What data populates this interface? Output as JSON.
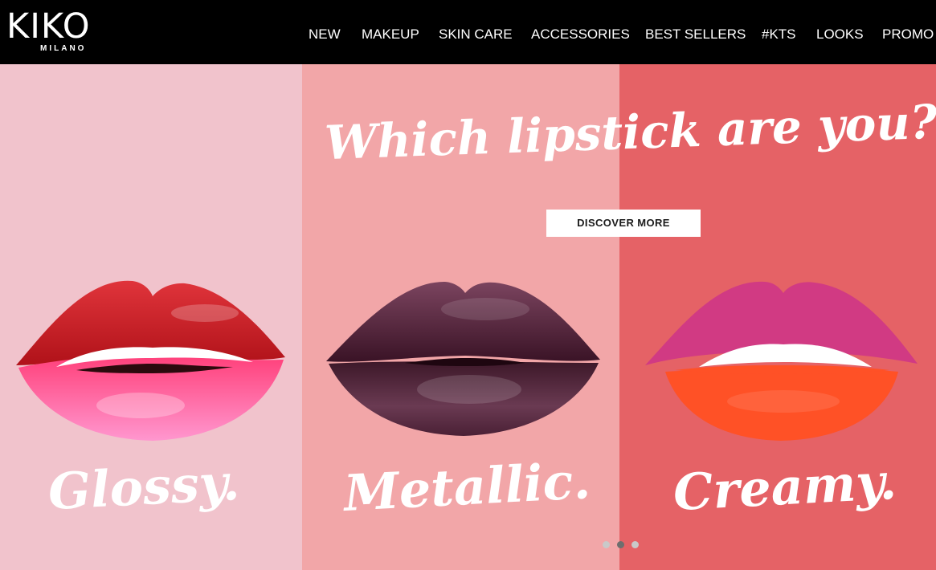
{
  "header": {
    "logo_main": "KIKO",
    "logo_sub": "MILANO",
    "nav": [
      "NEW",
      "MAKEUP",
      "SKIN CARE",
      "ACCESSORIES",
      "BEST SELLERS",
      "#KTS",
      "LOOKS",
      "PROMO"
    ]
  },
  "hero": {
    "headline": "Which lipstick are you?",
    "cta_label": "DISCOVER MORE",
    "panels": [
      {
        "label": "Glossy.",
        "color": "#f1c3cc"
      },
      {
        "label": "Metallic.",
        "color": "#f2a6a8"
      },
      {
        "label": "Creamy.",
        "color": "#e56266"
      }
    ]
  },
  "carousel": {
    "slides": 3,
    "active_index": 1
  },
  "colors": {
    "header_bg": "#000000",
    "glossy_top_lip": "#c7161f",
    "glossy_bottom_lip": "#ee5b9c",
    "metallic_lip": "#4f2539",
    "creamy_top_lip": "#d6357d",
    "creamy_bottom_lip": "#ff4a1f"
  }
}
